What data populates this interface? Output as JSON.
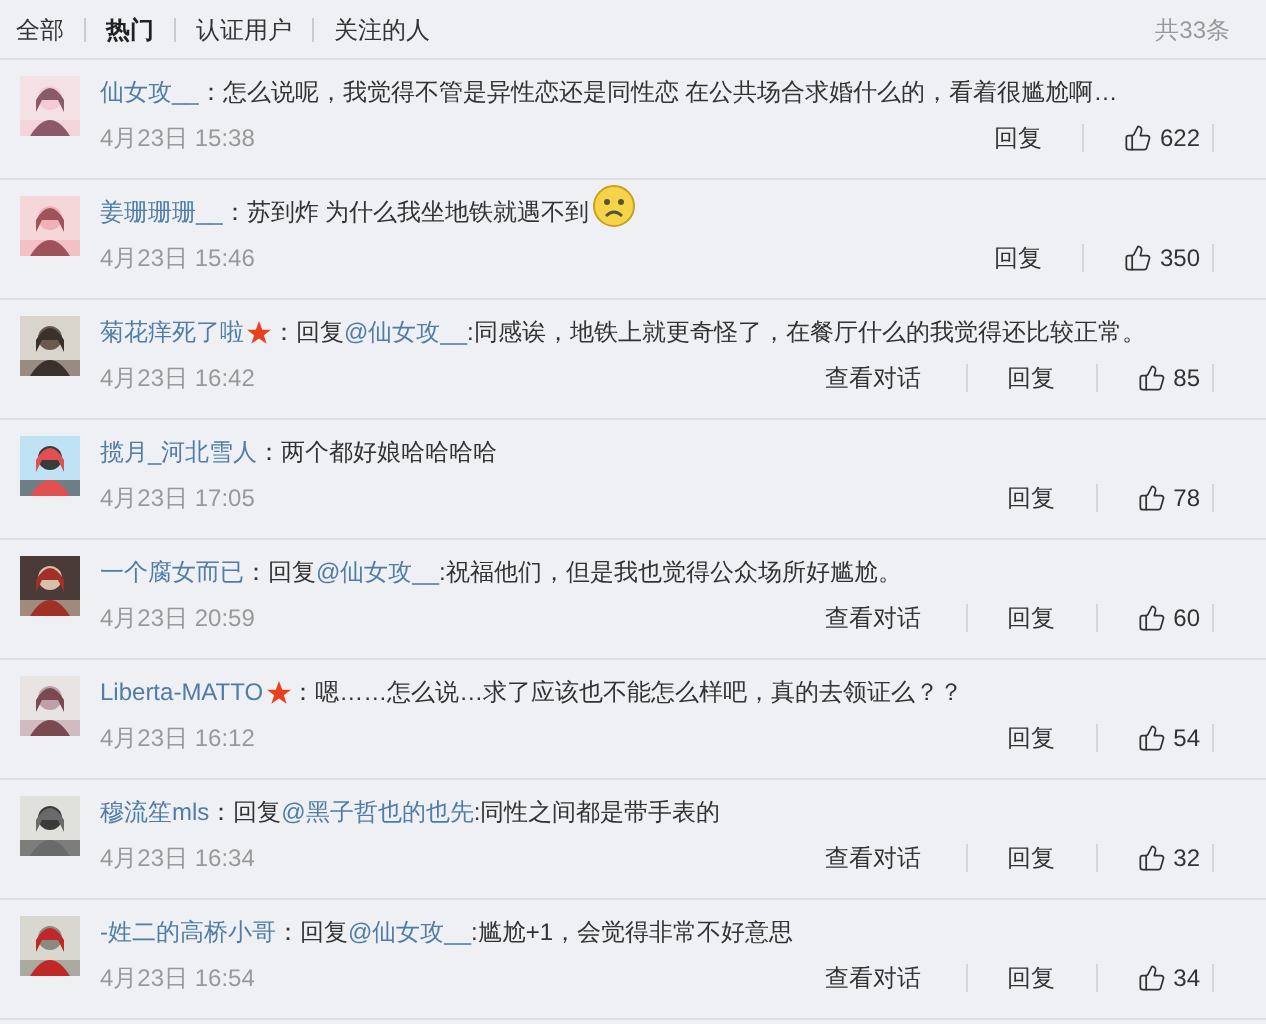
{
  "tabs": [
    {
      "label": "全部",
      "selected": false
    },
    {
      "label": "热门",
      "selected": true
    },
    {
      "label": "认证用户",
      "selected": false
    },
    {
      "label": "关注的人",
      "selected": false
    }
  ],
  "total": "共33条",
  "comments": [
    {
      "user": "仙女攻__",
      "verified": false,
      "text": "：怎么说呢，我觉得不管是异性恋还是同性恋 在公共场合求婚什么的，看着很尴尬啊…",
      "emoji": false,
      "time": "4月23日 15:38",
      "reply": "回复",
      "likes": "622"
    },
    {
      "user": "姜珊珊珊__",
      "verified": false,
      "text": "：苏到炸 为什么我坐地铁就遇不到",
      "emoji": true,
      "time": "4月23日 15:46",
      "reply": "回复",
      "likes": "350"
    },
    {
      "user": "菊花痒死了啦",
      "verified": true,
      "before_mention": "：回复",
      "mention": "@仙女攻__",
      "text": ":同感诶，地铁上就更奇怪了，在餐厅什么的我觉得还比较正常。",
      "emoji": false,
      "time": "4月23日 16:42",
      "view_dialog": "查看对话",
      "reply": "回复",
      "likes": "85"
    },
    {
      "user": "揽月_河北雪人",
      "verified": false,
      "text": "：两个都好娘哈哈哈哈",
      "emoji": false,
      "time": "4月23日 17:05",
      "reply": "回复",
      "likes": "78"
    },
    {
      "user": "一个腐女而已",
      "verified": false,
      "before_mention": "：回复",
      "mention": "@仙女攻__",
      "text": ":祝福他们，但是我也觉得公众场所好尴尬。",
      "emoji": false,
      "time": "4月23日 20:59",
      "view_dialog": "查看对话",
      "reply": "回复",
      "likes": "60"
    },
    {
      "user": "Liberta-MATTO",
      "verified": true,
      "text": "：嗯……怎么说…求了应该也不能怎么样吧，真的去领证么？？",
      "emoji": false,
      "time": "4月23日 16:12",
      "reply": "回复",
      "likes": "54"
    },
    {
      "user": "穆流笙mls",
      "verified": false,
      "before_mention": "：回复",
      "mention": "@黑子哲也的也先",
      "text": ":同性之间都是带手表的",
      "emoji": false,
      "time": "4月23日 16:34",
      "view_dialog": "查看对话",
      "reply": "回复",
      "likes": "32"
    },
    {
      "user": "-姓二的高桥小哥",
      "verified": false,
      "before_mention": "：回复",
      "mention": "@仙女攻__",
      "text": ":尴尬+1，会觉得非常不好意思",
      "emoji": false,
      "time": "4月23日 16:54",
      "view_dialog": "查看对话",
      "reply": "回复",
      "likes": "34"
    }
  ]
}
